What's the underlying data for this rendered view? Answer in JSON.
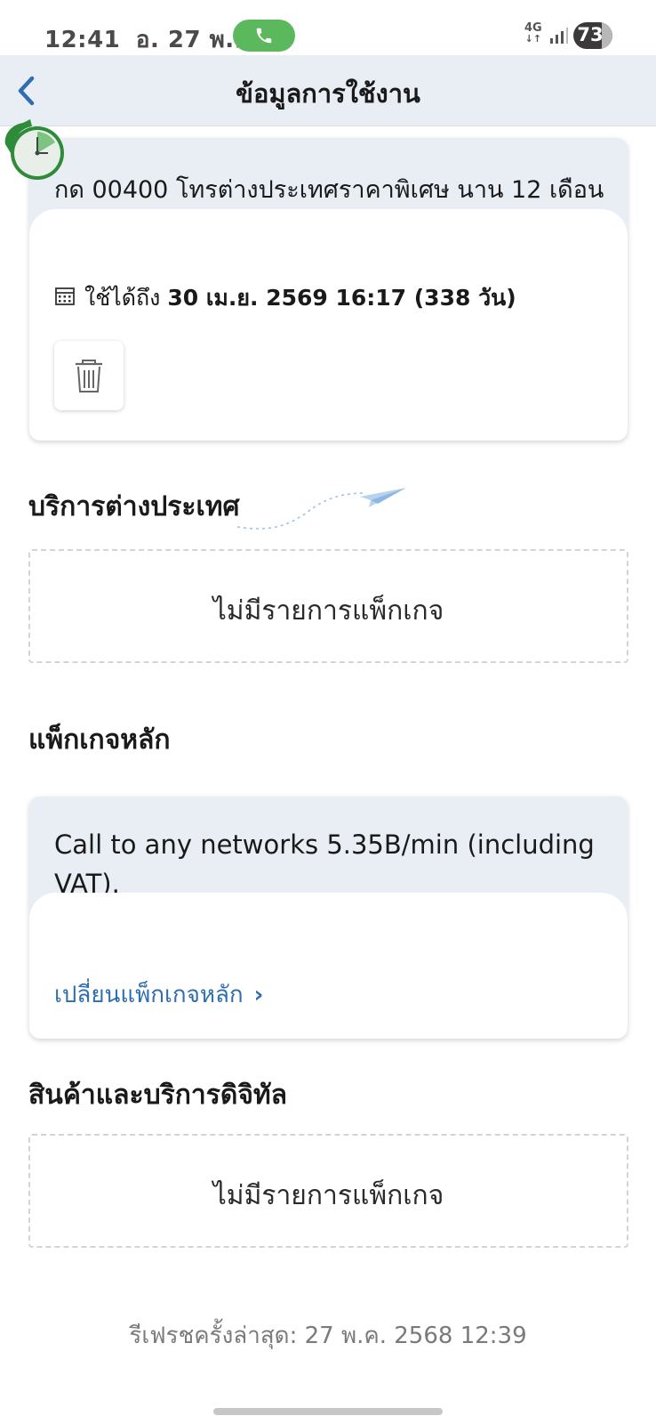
{
  "status_bar": {
    "time": "12:41",
    "date": "อ. 27 พ.ค.",
    "network": "4G",
    "battery": "73",
    "battery_level": 0.73,
    "call_color": "#5cb85c"
  },
  "header": {
    "title": "ข้อมูลการใช้งาน"
  },
  "package_card": {
    "title": "กด 00400 โทรต่างประเทศราคาพิเศษ นาน 12 เดือน",
    "valid_label": "ใช้ได้ถึง",
    "valid_value": "30 เม.ย. 2569 16:17 (338 วัน)"
  },
  "international_section": {
    "title": "บริการต่างประเทศ",
    "empty_text": "ไม่มีรายการแพ็กเกจ"
  },
  "main_package_section": {
    "title": "แพ็กเกจหลัก",
    "description": "Call to any networks 5.35B/min (including VAT).",
    "change_link": "เปลี่ยนแพ็กเกจหลัก",
    "link_color": "#2e6db0"
  },
  "digital_section": {
    "title": "สินค้าและบริการดิจิทัล",
    "empty_text": "ไม่มีรายการแพ็กเกจ"
  },
  "footer": {
    "refresh_text": "รีเฟรชครั้งล่าสุด: 27 พ.ค. 2568 12:39"
  },
  "icons": [
    "back-chevron-icon",
    "phone-icon",
    "signal-icon",
    "timer-phone-icon",
    "calendar-icon",
    "trash-icon",
    "paper-plane-icon",
    "chevron-right-icon"
  ]
}
